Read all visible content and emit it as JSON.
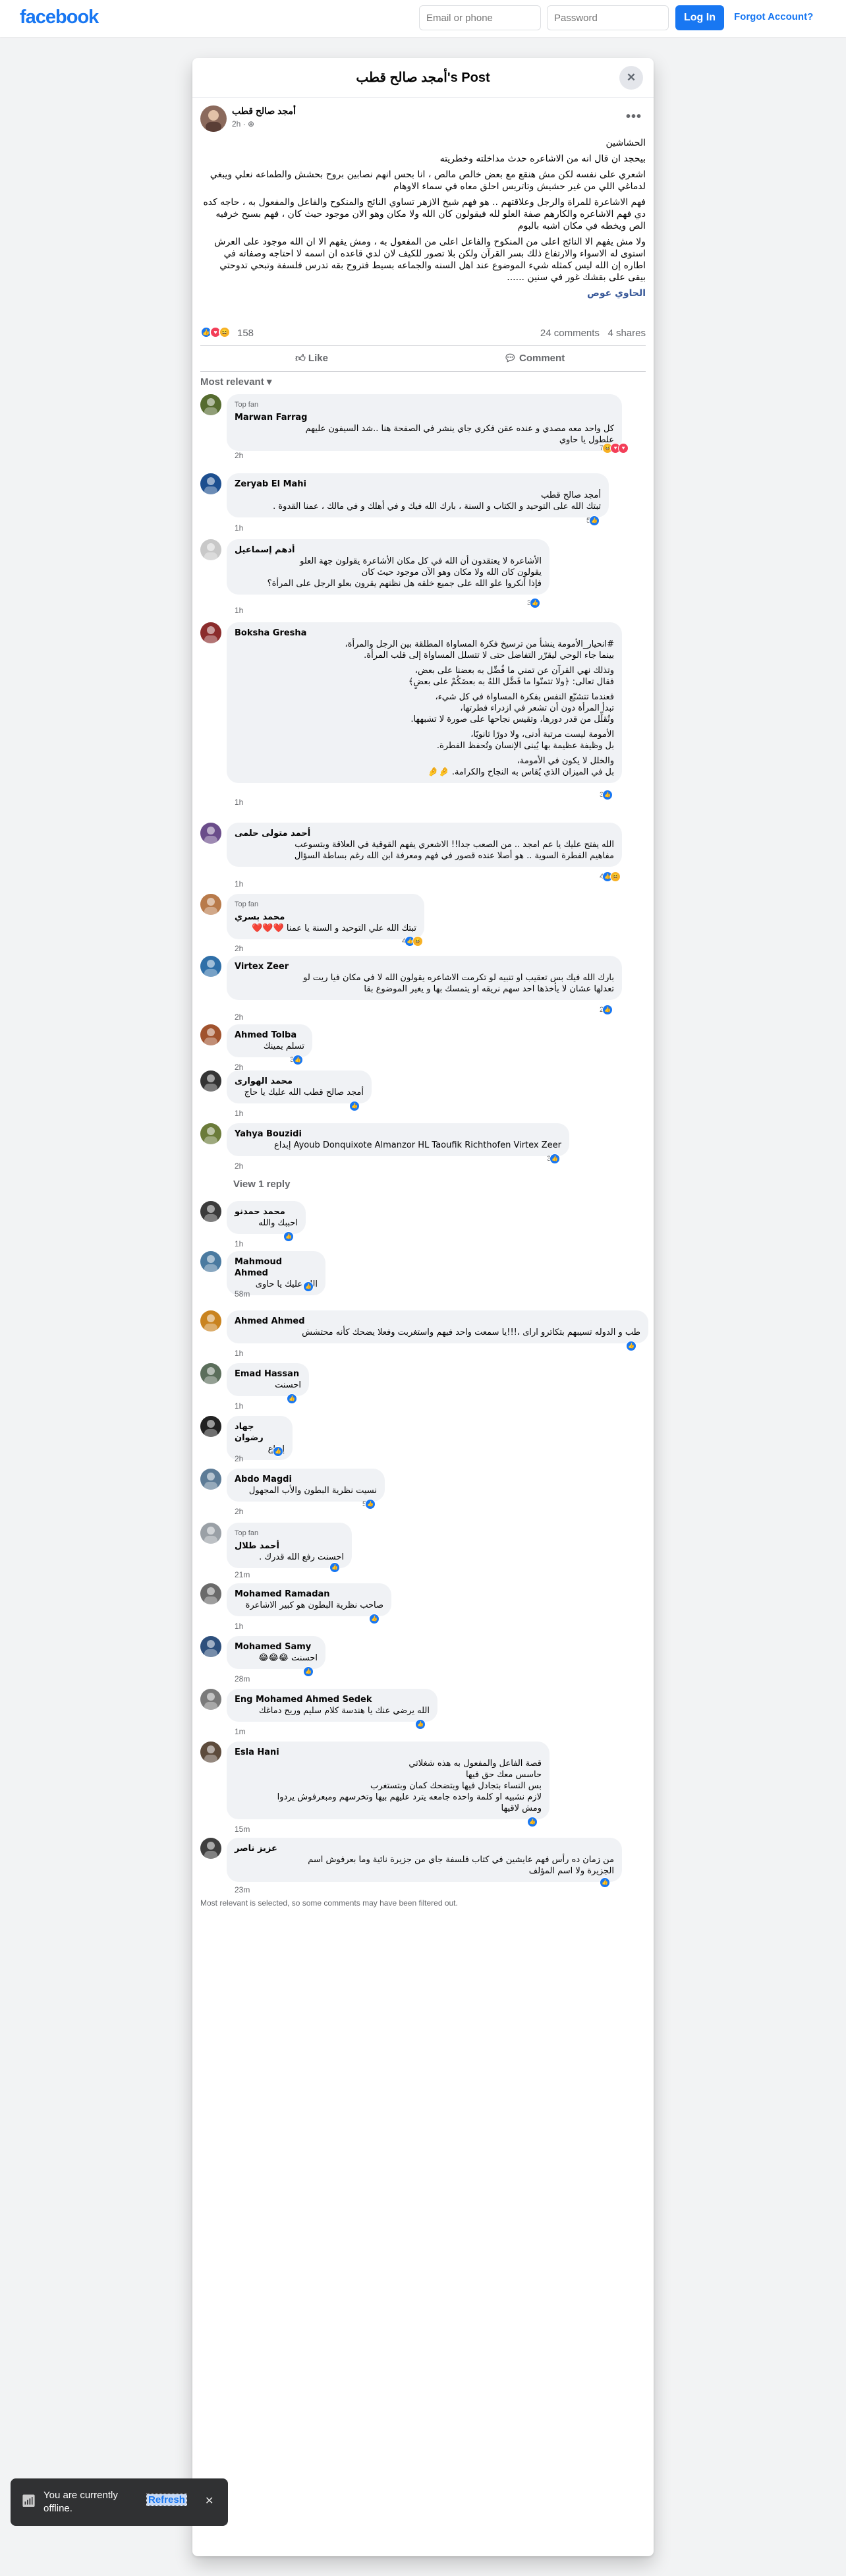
{
  "topbar": {
    "logo": "facebook",
    "email_placeholder": "Email or phone",
    "password_placeholder": "Password",
    "login_label": "Log In",
    "forgot_label": "Forgot Account?"
  },
  "post": {
    "title": "أمجد صالح قطب's Post",
    "author": "أمجد صالح قطب",
    "time": "2h · ⊕",
    "paragraphs": [
      "الحشاشين",
      "بيحجد ان قال انه من الاشاعره حدث مداخلته وخطريته",
      "اشعري على نفسه لكن مش هنقع مع بعض خالص مالص ، انا بحس انهم نصابين بروح بحشش والطماعه نعلي ويبغي لدماغي اللي من غير حشيش وتاتريس احلق معاه في سماء الاوهام",
      "فهم الاشاعرة للمراة والرجل وعلاقتهم .. هو فهم شيخ الازهر تساوي النائج والمنكوح والفاعل والمفعول به ، حاجه كده دي فهم الاشاعره والكارهم صفة العلو لله فيقولون كان الله ولا مكان وهو الان موجود حيث كان ، فهم بسبح خرفيه الص ويخطه في مكان اشبه بالبوم",
      "ولا مش يفهم الا النائج اعلى من المنكوح والفاعل اعلى من المفعول به ، ومش يفهم الا ان الله موجود على العرش استوى له الاسواء والارتفاع ذلك بسر القرآن ولكن بلا تصور للكيف لان لدي قاعده ان اسمه لا احتاجه وصفاته في اطاره إن الله ليس كمثله شيء الموضوع عند اهل السنه والجماعه بسيط فتروح بقه تدرس فلسفة وتبحي تدوحتي بيقى على بقشك غور في سنين ......"
    ],
    "tag": "الحاوي عوص",
    "reaction_count": "158",
    "comments_count": "24 comments",
    "shares_count": "4 shares",
    "like_label": "Like",
    "comment_label": "Comment",
    "most_relevant": "Most relevant ▾"
  },
  "comments": [
    {
      "name": "Marwan Farrag",
      "top": "Top fan",
      "text": [
        "كل واحد معه مصدي و عنده عقن فكري جاي ينشر في الصفحة هنا ..شد السيفون عليهم",
        "علطول يا حاوي"
      ],
      "time": "2h",
      "count": "7"
    },
    {
      "name": "Zeryab El Mahi",
      "top": "",
      "text": [
        "أمجد صالح قطب",
        "تبتك الله على التوحيد و الكتاب و السنة ، بارك الله فيك و في أهلك و في مالك ، عمنا القدوة ."
      ],
      "time": "1h",
      "count": "5"
    },
    {
      "name": "أدهم إسماعيل",
      "top": "",
      "text": [
        "الأشاعرة لا يعتقدون أن الله في كل مكان الأشاعرة يقولون جهة العلو",
        "يقولون كان الله ولا مكان وهو الآن موجود حيث كان",
        "فإذا أنكروا علو الله على جميع خلقه هل نظنهم يقرون بعلو الرجل على المرأة؟"
      ],
      "time": "1h",
      "count": "3"
    },
    {
      "name": "Boksha Gresha",
      "top": "",
      "text": [
        "#انحيار_الأمومة ينشأ من ترسيخ فكرة المساواة المطلقة بين الرجل والمرأة،",
        "بينما جاء الوحي ليقرّر التفاضل حتى لا تتسلل المساواة إلى قلب المرأة.",
        "",
        "وتذلك نهي القرآن عن تمني ما فُضِّل به بعضنا على بعض،",
        "فقال تعالى: ﴿ولا تتمنّوا ما فَضَّل اللهُ به بعضَكُمْ على بعضٍ﴾",
        "",
        "فعندما تتشبّع النفس بفكرة المساواة في كل شيء،",
        "تبدأ المرأة دون أن تشعر في ازدراء فطرتها،",
        "وتُقلِّل من قدر دورها، وتقيس نجاحها على صورة لا تشبهها.",
        "",
        "الأمومة ليست مرتبة أدنى، ولا دورًا ثانويًا،",
        "بل وظيفة عظيمة بها يُبنى الإنسان وتُحفظ الفطرة.",
        "",
        "والخلل لا يكون في الأمومة،",
        "بل في الميزان الذي يُقاس به النجاح والكرامة. 🤌🤌"
      ],
      "time": "1h",
      "count": "3"
    },
    {
      "name": "أحمد متولى حلمى",
      "top": "",
      "text": [
        "الله يفتح عليك يا عم امجد .. من الصعب جدا!! الاشعري يفهم القوقية في العلاقة وبتسوعب",
        "مفاهيم الفطرة السوية .. هو أصلا عنده قصور في فهم ومعرفة ابن الله رغم بساطة السؤال"
      ],
      "time": "1h",
      "count": "4"
    },
    {
      "name": "محمد بسري",
      "top": "Top fan",
      "text": [
        "تبتك الله علي التوحيد و السنة يا عمنا ❤️❤️❤️"
      ],
      "time": "2h",
      "count": "4"
    },
    {
      "name": "Virtex Zeer",
      "top": "",
      "text": [
        "بارك الله فيك بس تعقيب او تنبيه لو تكرمت الاشاعره يقولون الله لا في مكان فيا ريت لو",
        "تعدلها عشان لا يأخذها احد سهم نريقه او يتمسك بها و يغير الموضوع بقا"
      ],
      "time": "2h",
      "count": "2"
    },
    {
      "name": "Ahmed Tolba",
      "top": "",
      "text": [
        "تسلم يمينك"
      ],
      "time": "2h",
      "count": "3"
    },
    {
      "name": "محمد الهوارى",
      "top": "",
      "text": [
        "أمجد صالح قطب الله عليك يا حاج"
      ],
      "time": "1h",
      "count": ""
    },
    {
      "name": "Yahya Bouzidi",
      "top": "",
      "text": [
        "Ayoub Donquixote Almanzor HL Taoufik Richthofen Virtex Zeer إبداع"
      ],
      "time": "2h",
      "count": "3"
    },
    {
      "name": "محمد حمدنو",
      "top": "",
      "text": [
        "احببك والله"
      ],
      "time": "1h",
      "count": ""
    },
    {
      "name": "Mahmoud Ahmed",
      "top": "",
      "text": [
        "الله عليك يا حاوى"
      ],
      "time": "58m",
      "count": ""
    },
    {
      "name": "Ahmed Ahmed",
      "top": "",
      "text": [
        "طب و الدوله تسيبهم بتكاترو اراى ،!!!يا سمعت واحد فيهم واستغربت وفعلا يضحك كأنه محتشش"
      ],
      "time": "1h",
      "count": ""
    },
    {
      "name": "Emad Hassan",
      "top": "",
      "text": [
        "احسنت"
      ],
      "time": "1h",
      "count": ""
    },
    {
      "name": "جهاد رضوان",
      "top": "",
      "text": [
        "إبداع"
      ],
      "time": "2h",
      "count": "2"
    },
    {
      "name": "Abdo Magdi",
      "top": "",
      "text": [
        "نسيت نظرية البطون والأب المجهول"
      ],
      "time": "2h",
      "count": "5"
    },
    {
      "name": "أحمد طلال",
      "top": "Top fan",
      "text": [
        "احسنت رفع الله قدرك ."
      ],
      "time": "21m",
      "count": ""
    },
    {
      "name": "Mohamed Ramadan",
      "top": "",
      "text": [
        "صاحب نظرية البطون هو كبير الاشاعرة"
      ],
      "time": "1h",
      "count": ""
    },
    {
      "name": "Mohamed Samy",
      "top": "",
      "text": [
        "احسنت 😂😂😂"
      ],
      "time": "28m",
      "count": ""
    },
    {
      "name": "Eng Mohamed Ahmed Sedek",
      "top": "",
      "text": [
        "الله يرضي عنك يا هندسة كلام سليم وريح دماغك"
      ],
      "time": "1m",
      "count": ""
    },
    {
      "name": "Esla Hani",
      "top": "",
      "text": [
        "قصة الفاعل والمفعول به هذه شغلاتي",
        "حاسس معك حق فيها",
        "بس النساء بتجادل فيها وبتضحك كمان وبتستغرب",
        "لازم نشبيه او كلمة واحده جامعه يترد عليهم بيها وتخرسهم ومبعرفوش يردوا",
        "ومش لاقيها"
      ],
      "time": "15m",
      "count": ""
    },
    {
      "name": "عزيز ناصر",
      "top": "",
      "text": [
        "من زمان ده رأس فهم عايشين في كتاب فلسفة جاي من جزيرة نائية وما بعرفوش اسم",
        "الجزيرة ولا اسم المؤلف"
      ],
      "time": "23m",
      "count": ""
    }
  ],
  "view_reply": "View 1 reply",
  "footer_note": "Most relevant is selected, so some comments may have been filtered out.",
  "toast": {
    "message": "You are currently offline.",
    "refresh": "Refresh",
    "close": "✕"
  }
}
